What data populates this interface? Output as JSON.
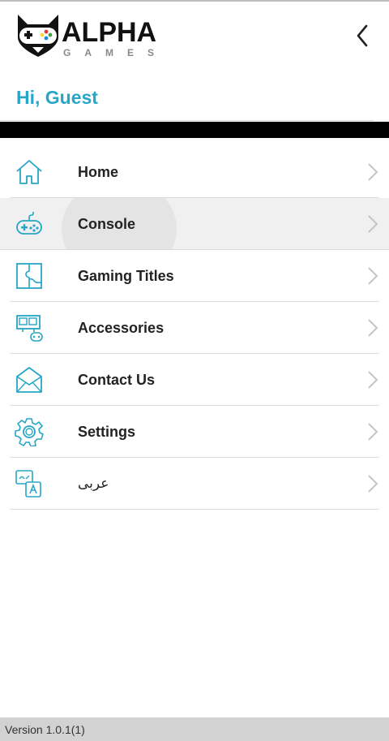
{
  "app": {
    "logo_main": "ALPHA",
    "logo_sub": "GAMES",
    "greeting": "Hi, Guest",
    "accent_color": "#27a6c6"
  },
  "menu": {
    "items": [
      {
        "label": "Home",
        "icon": "home-icon",
        "active": false
      },
      {
        "label": "Console",
        "icon": "gamepad-icon",
        "active": true
      },
      {
        "label": "Gaming Titles",
        "icon": "puzzle-icon",
        "active": false
      },
      {
        "label": "Accessories",
        "icon": "accessories-icon",
        "active": false
      },
      {
        "label": "Contact Us",
        "icon": "envelope-icon",
        "active": false
      },
      {
        "label": "Settings",
        "icon": "gear-icon",
        "active": false
      },
      {
        "label": "عربى",
        "icon": "language-icon",
        "active": false
      }
    ]
  },
  "footer": {
    "version": "Version 1.0.1(1)"
  }
}
